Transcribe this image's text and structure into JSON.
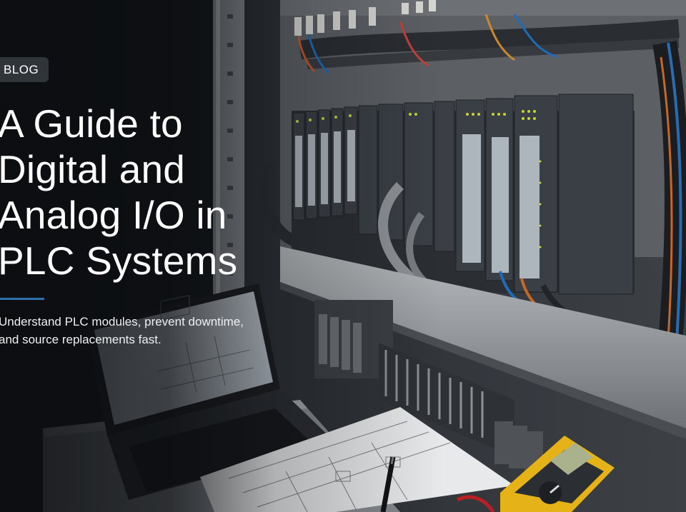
{
  "badge": {
    "label": "BLOG"
  },
  "title": "A Guide to Digital and Analog I/O in PLC Systems",
  "subtitle": "Understand PLC modules, prevent downtime, and source replacements fast.",
  "colors": {
    "accent": "#2f6fae",
    "badge_bg": "#34383e",
    "text": "#ffffff"
  }
}
